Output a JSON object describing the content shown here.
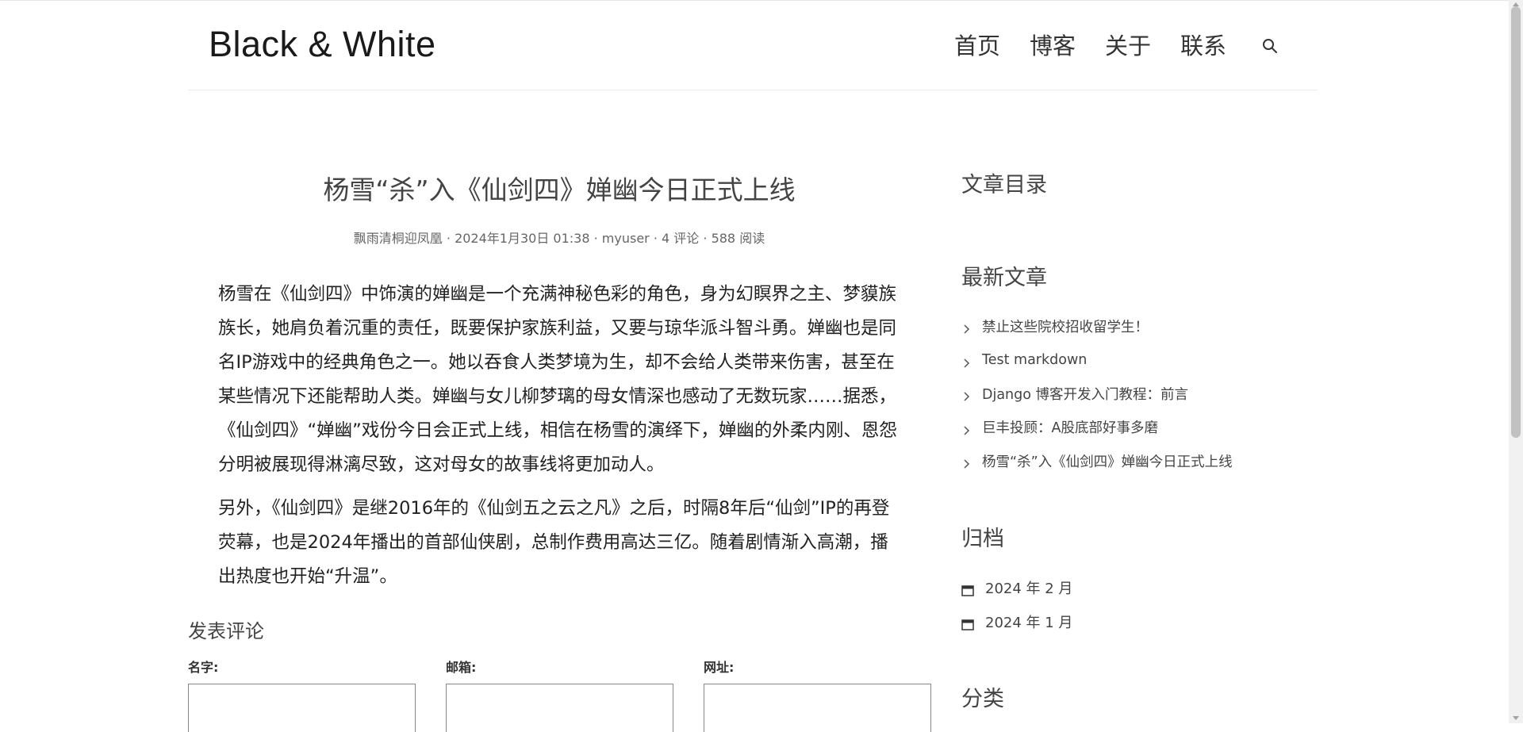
{
  "header": {
    "site_title": "Black & White",
    "nav": [
      "首页",
      "博客",
      "关于",
      "联系"
    ]
  },
  "article": {
    "title": "杨雪“杀”入《仙剑四》婵幽今日正式上线",
    "meta": {
      "category": "飘雨清桐迎凤凰",
      "date": "2024年1月30日 01:38",
      "author": "myuser",
      "comments": "4 评论",
      "views": "588 阅读"
    },
    "paragraphs": [
      "杨雪在《仙剑四》中饰演的婵幽是一个充满神秘色彩的角色，身为幻瞑界之主、梦貘族族长，她肩负着沉重的责任，既要保护家族利益，又要与琼华派斗智斗勇。婵幽也是同名IP游戏中的经典角色之一。她以吞食人类梦境为生，却不会给人类带来伤害，甚至在某些情况下还能帮助人类。婵幽与女儿柳梦璃的母女情深也感动了无数玩家……据悉，《仙剑四》“婵幽”戏份今日会正式上线，相信在杨雪的演绎下，婵幽的外柔内刚、恩怨分明被展现得淋漓尽致，这对母女的故事线将更加动人。",
      "另外，《仙剑四》是继2016年的《仙剑五之云之凡》之后，时隔8年后“仙剑”IP的再登荧幕，也是2024年播出的首部仙侠剧，总制作费用高达三亿。随着剧情渐入高潮，播出热度也开始“升温”。"
    ]
  },
  "comment_form": {
    "title": "发表评论",
    "fields": [
      "名字:",
      "邮箱:",
      "网址:"
    ]
  },
  "sidebar": {
    "toc_title": "文章目录",
    "recent_title": "最新文章",
    "recent_posts": [
      "禁止这些院校招收留学生！",
      "Test markdown",
      "Django 博客开发入门教程：前言",
      "巨丰投顾：A股底部好事多磨",
      "杨雪“杀”入《仙剑四》婵幽今日正式上线"
    ],
    "archive_title": "归档",
    "archives": [
      "2024 年 2 月",
      "2024 年 1 月"
    ],
    "category_title": "分类"
  },
  "colors": {
    "text": "#333333",
    "border": "#ececec"
  },
  "icons": {
    "search": "search-icon",
    "chevron": "chevron-right-icon",
    "calendar": "calendar-icon"
  }
}
